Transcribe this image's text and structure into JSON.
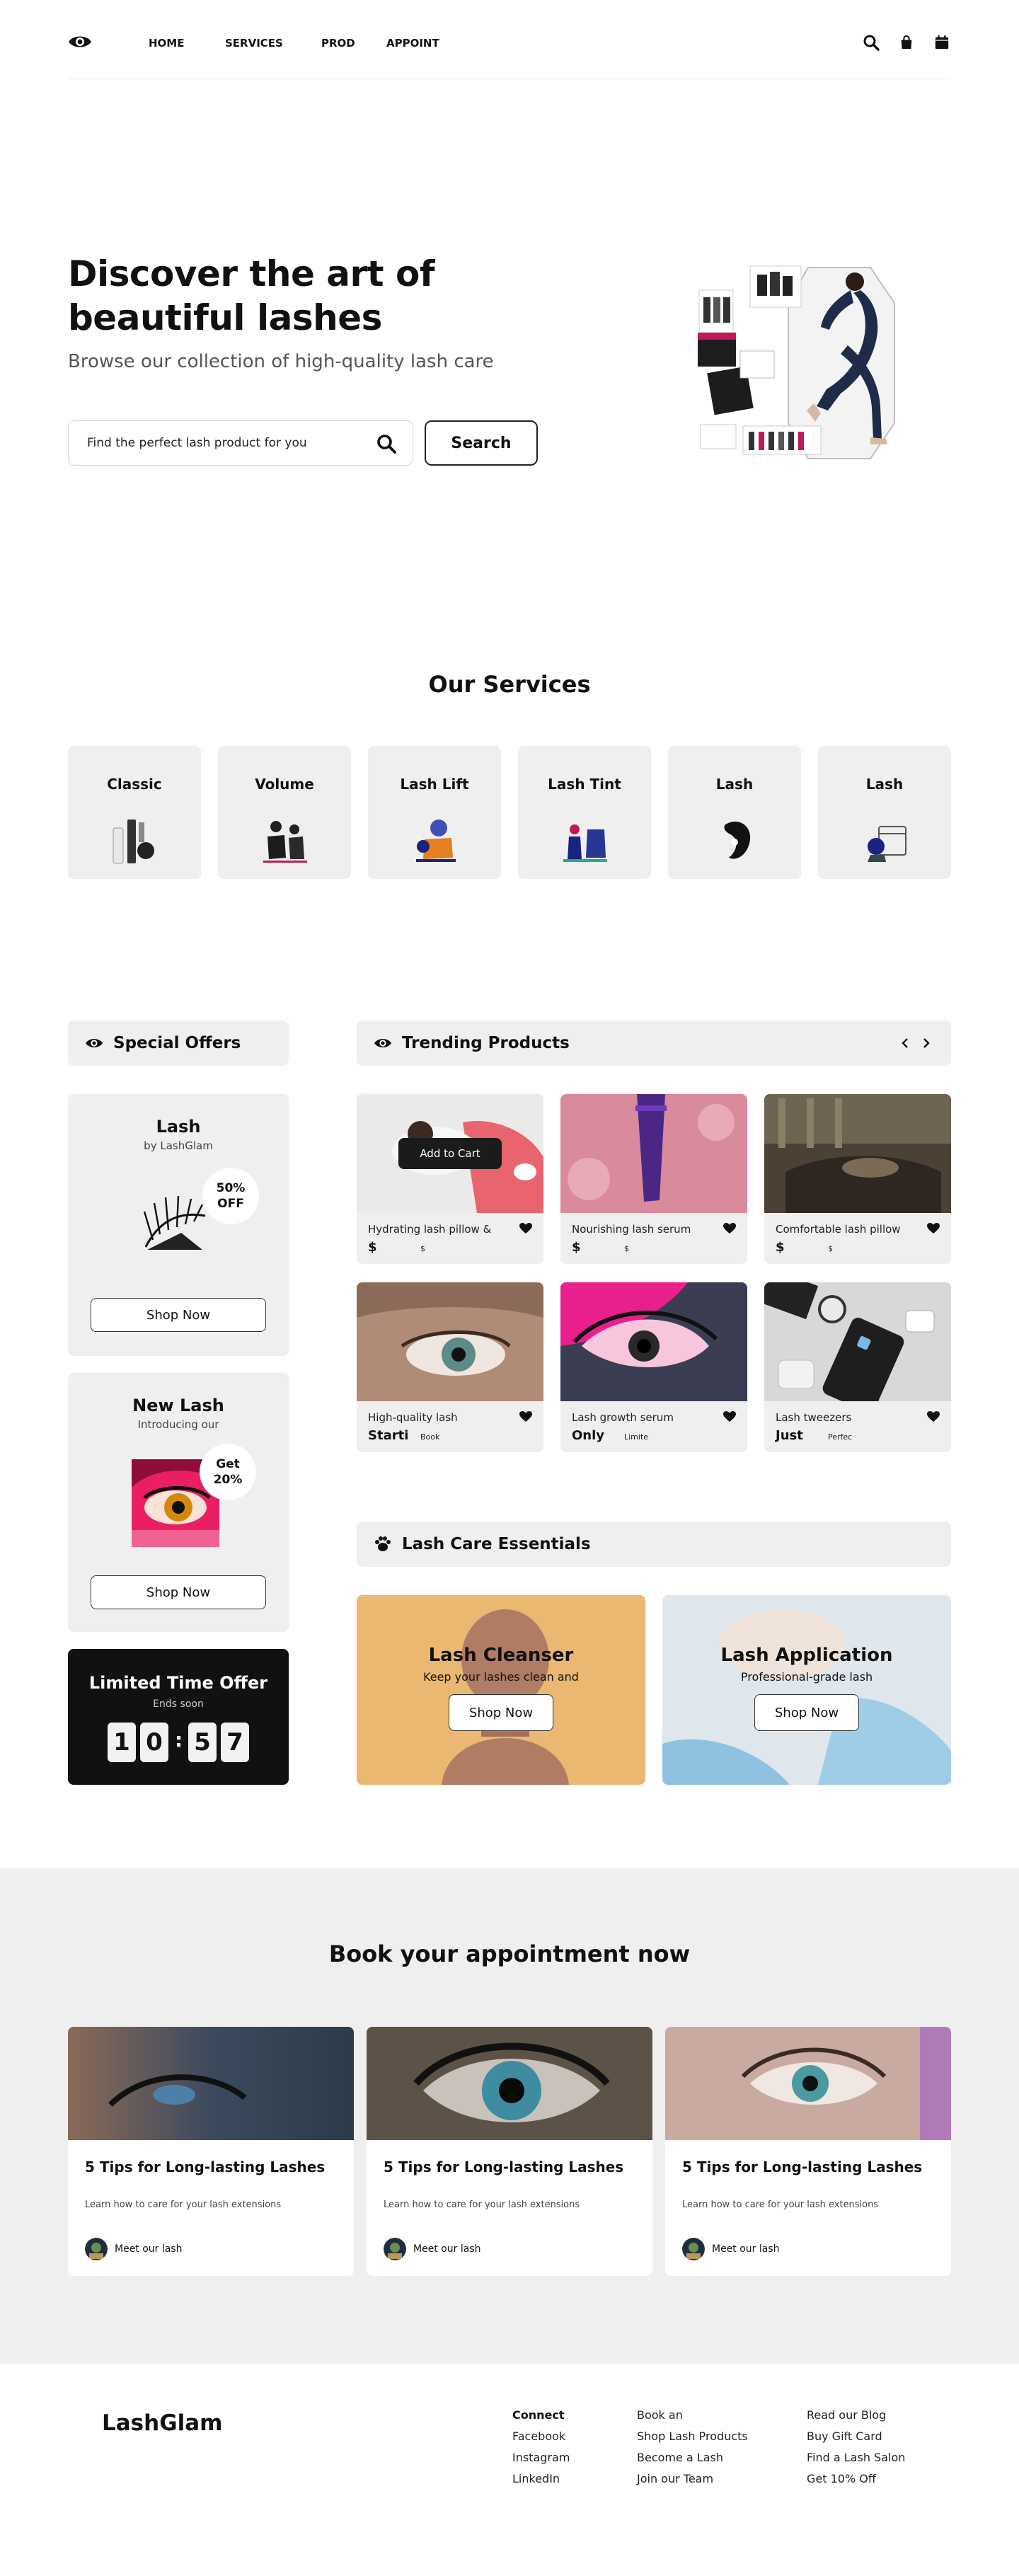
{
  "nav": {
    "links": [
      "HOME",
      "SERVICES",
      "PROD",
      "APPOINT"
    ],
    "icons": [
      "search-icon",
      "bag-icon",
      "calendar-icon"
    ]
  },
  "hero": {
    "title": "Discover the art of beautiful lashes",
    "subtitle": "Browse our collection of high-quality lash care",
    "search_placeholder": "Find the perfect lash product for you",
    "search_button": "Search"
  },
  "services": {
    "title": "Our Services",
    "items": [
      "Classic",
      "Volume",
      "Lash Lift",
      "Lash Tint",
      "Lash",
      "Lash"
    ]
  },
  "special_offers": {
    "title": "Special Offers",
    "cards": [
      {
        "title": "Lash",
        "subtitle": "by LashGlam",
        "badge": "50% OFF",
        "button": "Shop Now"
      },
      {
        "title": "New Lash",
        "subtitle": "Introducing our",
        "badge": "Get 20%",
        "button": "Shop Now"
      }
    ],
    "limited": {
      "title": "Limited Time Offer",
      "subtitle": "Ends soon",
      "digits": [
        "1",
        "0",
        "5",
        "7"
      ]
    }
  },
  "trending": {
    "title": "Trending Products",
    "add_to_cart": "Add to Cart",
    "products": [
      {
        "name": "Hydrating lash pillow &",
        "price": "$",
        "note": "$"
      },
      {
        "name": "Nourishing lash serum",
        "price": "$",
        "note": "$"
      },
      {
        "name": "Comfortable lash pillow",
        "price": "$",
        "note": "$"
      },
      {
        "name": "High-quality lash",
        "price": "Starti",
        "note": "Book"
      },
      {
        "name": "Lash growth serum",
        "price": "Only",
        "note": "Limite"
      },
      {
        "name": "Lash tweezers",
        "price": "Just",
        "note": "Perfec"
      }
    ]
  },
  "essentials": {
    "title": "Lash Care Essentials",
    "cards": [
      {
        "title": "Lash Cleanser",
        "subtitle": "Keep your lashes clean and",
        "button": "Shop Now"
      },
      {
        "title": "Lash Application",
        "subtitle": "Professional-grade lash",
        "button": "Shop Now"
      }
    ]
  },
  "booking": {
    "title": "Book your appointment now",
    "posts": [
      {
        "title": "5 Tips for Long-lasting Lashes",
        "summary": "Learn how to care for your lash extensions",
        "author": "Meet our lash"
      },
      {
        "title": "5 Tips for Long-lasting Lashes",
        "summary": "Learn how to care for your lash extensions",
        "author": "Meet our lash"
      },
      {
        "title": "5 Tips for Long-lasting Lashes",
        "summary": "Learn how to care for your lash extensions",
        "author": "Meet our lash"
      }
    ]
  },
  "footer": {
    "brand": "LashGlam",
    "col1": [
      "Connect",
      "Facebook",
      "Instagram",
      "LinkedIn"
    ],
    "col2": [
      "Book an",
      "Shop Lash Products",
      "Become a Lash",
      "Join our Team"
    ],
    "col3": [
      "Read our Blog",
      "Buy Gift Card",
      "Find a Lash Salon",
      "Get 10% Off"
    ]
  }
}
